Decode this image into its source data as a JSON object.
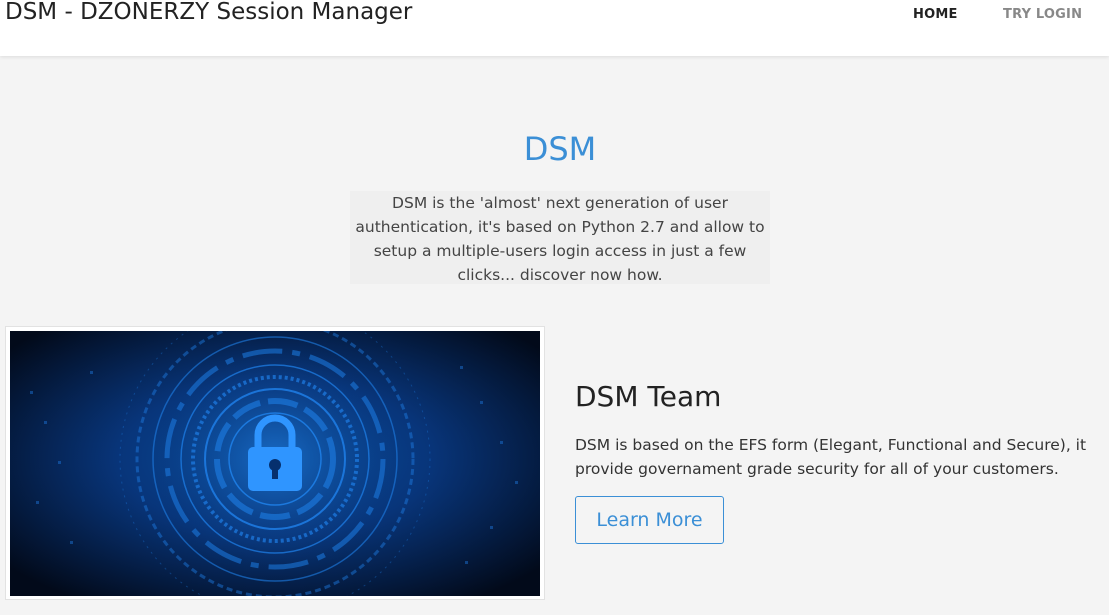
{
  "navbar": {
    "brand": "DSM - DZONERZY Session Manager",
    "links": [
      {
        "label": "HOME",
        "active": true
      },
      {
        "label": "TRY LOGIN",
        "active": false
      }
    ]
  },
  "hero": {
    "title": "DSM",
    "text": "DSM is the 'almost' next generation of user authentication, it's based on Python 2.7 and allow to setup a multiple-users login access in just a few clicks... discover now how."
  },
  "feature": {
    "image_icon": "padlock-icon",
    "title": "DSM Team",
    "text": "DSM is based on the EFS form (Elegant, Functional and Secure), it provide governament grade security for all of your customers.",
    "button_label": "Learn More"
  },
  "colors": {
    "accent": "#3b8fd6",
    "background": "#f4f4f4",
    "navbar": "#ffffff"
  }
}
